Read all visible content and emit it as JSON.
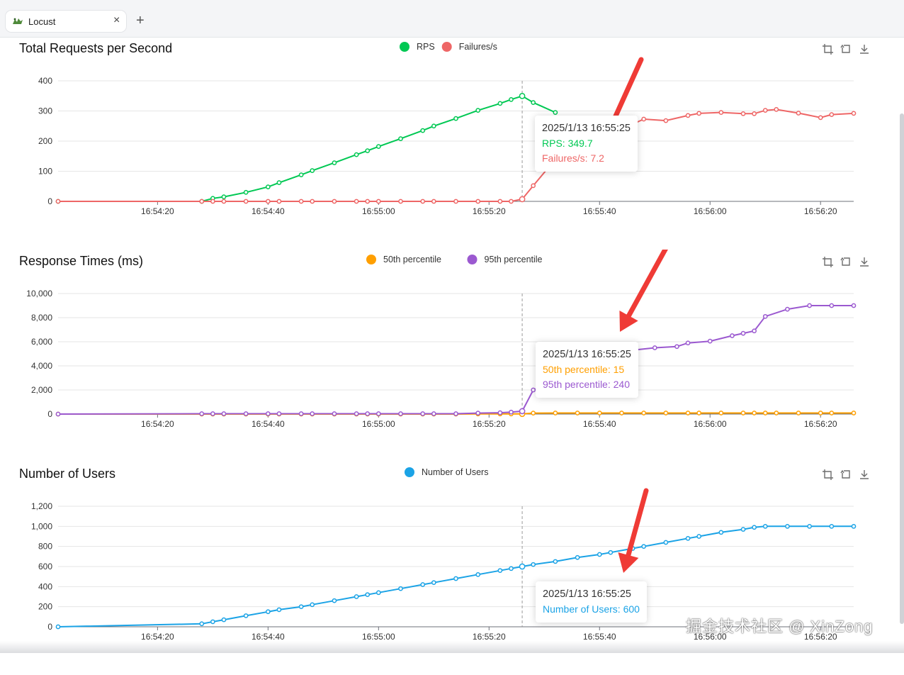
{
  "browser": {
    "tab_title": "Locust",
    "new_tab_label": "+",
    "close_label": "×"
  },
  "chart_data": [
    {
      "type": "line",
      "title": "Total Requests per Second",
      "x_ticks": [
        "16:54:20",
        "16:54:40",
        "16:55:00",
        "16:55:20",
        "16:55:40",
        "16:56:00",
        "16:56:20"
      ],
      "ylim": [
        0,
        400
      ],
      "y_ticks": [
        "0",
        "100",
        "200",
        "300",
        "400"
      ],
      "legend_position": "top-center",
      "series": [
        {
          "name": "RPS",
          "color": "#00c853",
          "points": [
            [
              "16:54:02",
              0
            ],
            [
              "16:54:28",
              0
            ],
            [
              "16:54:30",
              10
            ],
            [
              "16:54:32",
              15
            ],
            [
              "16:54:36",
              30
            ],
            [
              "16:54:40",
              48
            ],
            [
              "16:54:42",
              62
            ],
            [
              "16:54:46",
              88
            ],
            [
              "16:54:48",
              102
            ],
            [
              "16:54:52",
              128
            ],
            [
              "16:54:56",
              155
            ],
            [
              "16:54:58",
              168
            ],
            [
              "16:55:00",
              182
            ],
            [
              "16:55:04",
              208
            ],
            [
              "16:55:08",
              235
            ],
            [
              "16:55:10",
              250
            ],
            [
              "16:55:14",
              275
            ],
            [
              "16:55:18",
              302
            ],
            [
              "16:55:22",
              325
            ],
            [
              "16:55:24",
              338
            ],
            [
              "16:55:26",
              349.7
            ],
            [
              "16:55:28",
              328
            ],
            [
              "16:55:32",
              295
            ]
          ]
        },
        {
          "name": "Failures/s",
          "color": "#ee6666",
          "points": [
            [
              "16:54:02",
              0
            ],
            [
              "16:54:28",
              0
            ],
            [
              "16:54:30",
              0
            ],
            [
              "16:54:32",
              0
            ],
            [
              "16:54:36",
              0
            ],
            [
              "16:54:40",
              0
            ],
            [
              "16:54:42",
              0
            ],
            [
              "16:54:46",
              0
            ],
            [
              "16:54:48",
              0
            ],
            [
              "16:54:52",
              0
            ],
            [
              "16:54:56",
              0
            ],
            [
              "16:54:58",
              0
            ],
            [
              "16:55:00",
              0
            ],
            [
              "16:55:04",
              0
            ],
            [
              "16:55:08",
              0
            ],
            [
              "16:55:10",
              0
            ],
            [
              "16:55:14",
              0
            ],
            [
              "16:55:18",
              0
            ],
            [
              "16:55:22",
              0
            ],
            [
              "16:55:24",
              0
            ],
            [
              "16:55:26",
              7.2
            ],
            [
              "16:55:28",
              52
            ],
            [
              "16:55:32",
              140
            ],
            [
              "16:55:48",
              273
            ],
            [
              "16:55:52",
              268
            ],
            [
              "16:55:56",
              285
            ],
            [
              "16:55:58",
              292
            ],
            [
              "16:56:02",
              295
            ],
            [
              "16:56:06",
              291
            ],
            [
              "16:56:08",
              291
            ],
            [
              "16:56:10",
              302
            ],
            [
              "16:56:12",
              305
            ],
            [
              "16:56:16",
              293
            ],
            [
              "16:56:20",
              278
            ],
            [
              "16:56:22",
              288
            ],
            [
              "16:56:26",
              292
            ]
          ]
        }
      ],
      "tooltip": {
        "time": "2025/1/13 16:55:25",
        "lines": [
          "RPS: 349.7",
          "Failures/s: 7.2"
        ]
      }
    },
    {
      "type": "line",
      "title": "Response Times (ms)",
      "x_ticks": [
        "16:54:20",
        "16:54:40",
        "16:55:00",
        "16:55:20",
        "16:55:40",
        "16:56:00",
        "16:56:20"
      ],
      "ylim": [
        0,
        10000
      ],
      "y_ticks": [
        "0",
        "2,000",
        "4,000",
        "6,000",
        "8,000",
        "10,000"
      ],
      "legend_position": "top-center",
      "series": [
        {
          "name": "50th percentile",
          "color": "#ff9f00",
          "points": [
            [
              "16:54:02",
              0
            ],
            [
              "16:54:28",
              0
            ],
            [
              "16:54:30",
              0
            ],
            [
              "16:54:32",
              0
            ],
            [
              "16:54:36",
              0
            ],
            [
              "16:54:40",
              0
            ],
            [
              "16:54:42",
              0
            ],
            [
              "16:54:46",
              0
            ],
            [
              "16:54:48",
              0
            ],
            [
              "16:54:52",
              0
            ],
            [
              "16:54:56",
              0
            ],
            [
              "16:54:58",
              0
            ],
            [
              "16:55:00",
              0
            ],
            [
              "16:55:04",
              0
            ],
            [
              "16:55:08",
              0
            ],
            [
              "16:55:10",
              0
            ],
            [
              "16:55:14",
              0
            ],
            [
              "16:55:18",
              10
            ],
            [
              "16:55:22",
              10
            ],
            [
              "16:55:24",
              10
            ],
            [
              "16:55:26",
              15
            ],
            [
              "16:55:28",
              80
            ],
            [
              "16:55:32",
              90
            ],
            [
              "16:55:36",
              90
            ],
            [
              "16:55:40",
              90
            ],
            [
              "16:55:44",
              90
            ],
            [
              "16:55:48",
              90
            ],
            [
              "16:55:52",
              90
            ],
            [
              "16:55:56",
              90
            ],
            [
              "16:55:58",
              90
            ],
            [
              "16:56:02",
              90
            ],
            [
              "16:56:06",
              90
            ],
            [
              "16:56:08",
              90
            ],
            [
              "16:56:10",
              90
            ],
            [
              "16:56:12",
              90
            ],
            [
              "16:56:16",
              90
            ],
            [
              "16:56:20",
              90
            ],
            [
              "16:56:22",
              90
            ],
            [
              "16:56:26",
              90
            ]
          ]
        },
        {
          "name": "95th percentile",
          "color": "#9b59d0",
          "points": [
            [
              "16:54:02",
              0
            ],
            [
              "16:54:28",
              30
            ],
            [
              "16:54:30",
              30
            ],
            [
              "16:54:32",
              30
            ],
            [
              "16:54:36",
              30
            ],
            [
              "16:54:40",
              30
            ],
            [
              "16:54:42",
              30
            ],
            [
              "16:54:46",
              30
            ],
            [
              "16:54:48",
              30
            ],
            [
              "16:54:52",
              30
            ],
            [
              "16:54:56",
              30
            ],
            [
              "16:54:58",
              30
            ],
            [
              "16:55:00",
              30
            ],
            [
              "16:55:04",
              30
            ],
            [
              "16:55:08",
              30
            ],
            [
              "16:55:10",
              30
            ],
            [
              "16:55:14",
              30
            ],
            [
              "16:55:18",
              80
            ],
            [
              "16:55:22",
              110
            ],
            [
              "16:55:24",
              160
            ],
            [
              "16:55:26",
              240
            ],
            [
              "16:55:28",
              2000
            ],
            [
              "16:55:46",
              5300
            ],
            [
              "16:55:50",
              5500
            ],
            [
              "16:55:54",
              5600
            ],
            [
              "16:55:56",
              5900
            ],
            [
              "16:56:00",
              6050
            ],
            [
              "16:56:04",
              6500
            ],
            [
              "16:56:06",
              6700
            ],
            [
              "16:56:08",
              6900
            ],
            [
              "16:56:10",
              8100
            ],
            [
              "16:56:14",
              8700
            ],
            [
              "16:56:18",
              9000
            ],
            [
              "16:56:22",
              9000
            ],
            [
              "16:56:26",
              9000
            ]
          ]
        }
      ],
      "tooltip": {
        "time": "2025/1/13 16:55:25",
        "lines": [
          "50th percentile: 15",
          "95th percentile: 240"
        ]
      }
    },
    {
      "type": "line",
      "title": "Number of Users",
      "x_ticks": [
        "16:54:20",
        "16:54:40",
        "16:55:00",
        "16:55:20",
        "16:55:40",
        "16:56:00",
        "16:56:20"
      ],
      "ylim": [
        0,
        1200
      ],
      "y_ticks": [
        "0",
        "200",
        "400",
        "600",
        "800",
        "1,000",
        "1,200"
      ],
      "legend_position": "top-center",
      "series": [
        {
          "name": "Number of Users",
          "color": "#1ba3e6",
          "points": [
            [
              "16:54:02",
              0
            ],
            [
              "16:54:28",
              30
            ],
            [
              "16:54:30",
              50
            ],
            [
              "16:54:32",
              70
            ],
            [
              "16:54:36",
              110
            ],
            [
              "16:54:40",
              150
            ],
            [
              "16:54:42",
              170
            ],
            [
              "16:54:46",
              200
            ],
            [
              "16:54:48",
              220
            ],
            [
              "16:54:52",
              260
            ],
            [
              "16:54:56",
              300
            ],
            [
              "16:54:58",
              320
            ],
            [
              "16:55:00",
              340
            ],
            [
              "16:55:04",
              380
            ],
            [
              "16:55:08",
              420
            ],
            [
              "16:55:10",
              440
            ],
            [
              "16:55:14",
              480
            ],
            [
              "16:55:18",
              520
            ],
            [
              "16:55:22",
              560
            ],
            [
              "16:55:24",
              580
            ],
            [
              "16:55:26",
              600
            ],
            [
              "16:55:28",
              620
            ],
            [
              "16:55:32",
              650
            ],
            [
              "16:55:36",
              690
            ],
            [
              "16:55:40",
              720
            ],
            [
              "16:55:42",
              740
            ],
            [
              "16:55:46",
              780
            ],
            [
              "16:55:48",
              800
            ],
            [
              "16:55:52",
              840
            ],
            [
              "16:55:56",
              880
            ],
            [
              "16:55:58",
              900
            ],
            [
              "16:56:02",
              940
            ],
            [
              "16:56:06",
              970
            ],
            [
              "16:56:08",
              990
            ],
            [
              "16:56:10",
              1000
            ],
            [
              "16:56:14",
              1000
            ],
            [
              "16:56:18",
              1000
            ],
            [
              "16:56:22",
              1000
            ],
            [
              "16:56:26",
              1000
            ]
          ]
        }
      ],
      "tooltip": {
        "time": "2025/1/13 16:55:25",
        "lines": [
          "Number of Users: 600"
        ]
      }
    }
  ],
  "toolbox": {
    "zoom_icon": "zoom-icon",
    "restore_icon": "restore-icon",
    "download_icon": "download-icon"
  },
  "watermark": "掘金技术社区 @ XinZong",
  "annotation_color": "#ef3b36"
}
